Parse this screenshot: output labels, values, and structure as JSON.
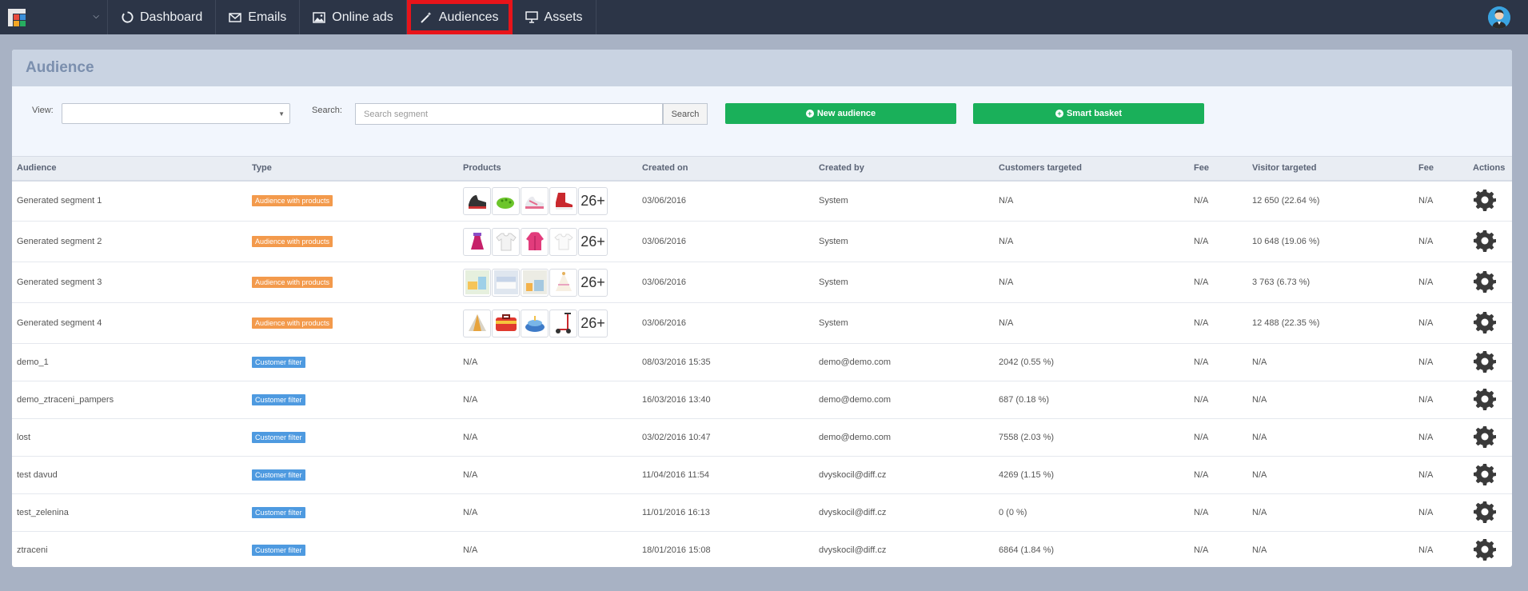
{
  "nav": {
    "items": [
      {
        "label": "Dashboard",
        "icon": "circle-notch-icon",
        "active": false
      },
      {
        "label": "Emails",
        "icon": "envelope-icon",
        "active": false
      },
      {
        "label": "Online ads",
        "icon": "image-icon",
        "active": false
      },
      {
        "label": "Audiences",
        "icon": "magic-wand-icon",
        "active": true
      },
      {
        "label": "Assets",
        "icon": "monitor-icon",
        "active": false
      }
    ]
  },
  "panel": {
    "title": "Audience"
  },
  "filters": {
    "view_label": "View:",
    "view_value": "",
    "search_label": "Search:",
    "search_placeholder": "Search segment",
    "search_button": "Search",
    "new_audience_button": "New audience",
    "smart_basket_button": "Smart basket"
  },
  "table": {
    "headers": [
      "Audience",
      "Type",
      "Products",
      "Created on",
      "Created by",
      "Customers targeted",
      "Fee",
      "Visitor targeted",
      "Fee",
      "Actions"
    ],
    "rows": [
      {
        "audience": "Generated segment 1",
        "type": "Audience with products",
        "type_kind": "orange",
        "products": [
          "shoe-thumbnail",
          "clog-thumbnail",
          "sneaker-thumbnail",
          "boot-thumbnail"
        ],
        "products_more": "26+",
        "created_on": "03/06/2016",
        "created_by": "System",
        "customers": "N/A",
        "fee1": "N/A",
        "visitors": "12 650 (22.64 %)",
        "fee2": "N/A"
      },
      {
        "audience": "Generated segment 2",
        "type": "Audience with products",
        "type_kind": "orange",
        "products": [
          "dress-thumbnail",
          "shirt-thumbnail",
          "jacket-thumbnail",
          "top-thumbnail"
        ],
        "products_more": "26+",
        "created_on": "03/06/2016",
        "created_by": "System",
        "customers": "N/A",
        "fee1": "N/A",
        "visitors": "10 648 (19.06 %)",
        "fee2": "N/A"
      },
      {
        "audience": "Generated segment 3",
        "type": "Audience with products",
        "type_kind": "orange",
        "products": [
          "room-thumbnail",
          "bed-thumbnail",
          "nursery-thumbnail",
          "canopy-thumbnail"
        ],
        "products_more": "26+",
        "created_on": "03/06/2016",
        "created_by": "System",
        "customers": "N/A",
        "fee1": "N/A",
        "visitors": "3 763 (6.73 %)",
        "fee2": "N/A"
      },
      {
        "audience": "Generated segment 4",
        "type": "Audience with products",
        "type_kind": "orange",
        "products": [
          "tent-thumbnail",
          "suitcase-thumbnail",
          "cake-thumbnail",
          "scooter-thumbnail"
        ],
        "products_more": "26+",
        "created_on": "03/06/2016",
        "created_by": "System",
        "customers": "N/A",
        "fee1": "N/A",
        "visitors": "12 488 (22.35 %)",
        "fee2": "N/A"
      },
      {
        "audience": "demo_1",
        "type": "Customer filter",
        "type_kind": "blue",
        "products_text": "N/A",
        "created_on": "08/03/2016 15:35",
        "created_by": "demo@demo.com",
        "customers": "2042 (0.55 %)",
        "fee1": "N/A",
        "visitors": "N/A",
        "fee2": "N/A"
      },
      {
        "audience": "demo_ztraceni_pampers",
        "type": "Customer filter",
        "type_kind": "blue",
        "products_text": "N/A",
        "created_on": "16/03/2016 13:40",
        "created_by": "demo@demo.com",
        "customers": "687 (0.18 %)",
        "fee1": "N/A",
        "visitors": "N/A",
        "fee2": "N/A"
      },
      {
        "audience": "lost",
        "type": "Customer filter",
        "type_kind": "blue",
        "products_text": "N/A",
        "created_on": "03/02/2016 10:47",
        "created_by": "demo@demo.com",
        "customers": "7558 (2.03 %)",
        "fee1": "N/A",
        "visitors": "N/A",
        "fee2": "N/A"
      },
      {
        "audience": "test davud",
        "type": "Customer filter",
        "type_kind": "blue",
        "products_text": "N/A",
        "created_on": "11/04/2016 11:54",
        "created_by": "dvyskocil@diff.cz",
        "customers": "4269 (1.15 %)",
        "fee1": "N/A",
        "visitors": "N/A",
        "fee2": "N/A"
      },
      {
        "audience": "test_zelenina",
        "type": "Customer filter",
        "type_kind": "blue",
        "products_text": "N/A",
        "created_on": "11/01/2016 16:13",
        "created_by": "dvyskocil@diff.cz",
        "customers": "0 (0 %)",
        "fee1": "N/A",
        "visitors": "N/A",
        "fee2": "N/A"
      },
      {
        "audience": "ztraceni",
        "type": "Customer filter",
        "type_kind": "blue",
        "products_text": "N/A",
        "created_on": "18/01/2016 15:08",
        "created_by": "dvyskocil@diff.cz",
        "customers": "6864 (1.84 %)",
        "fee1": "N/A",
        "visitors": "N/A",
        "fee2": "N/A"
      }
    ]
  },
  "colors": {
    "topbar": "#2c3547",
    "active_outline": "#e8141a",
    "green_button": "#1ab05a",
    "badge_orange": "#f39a4c",
    "badge_blue": "#4e9ae0"
  }
}
